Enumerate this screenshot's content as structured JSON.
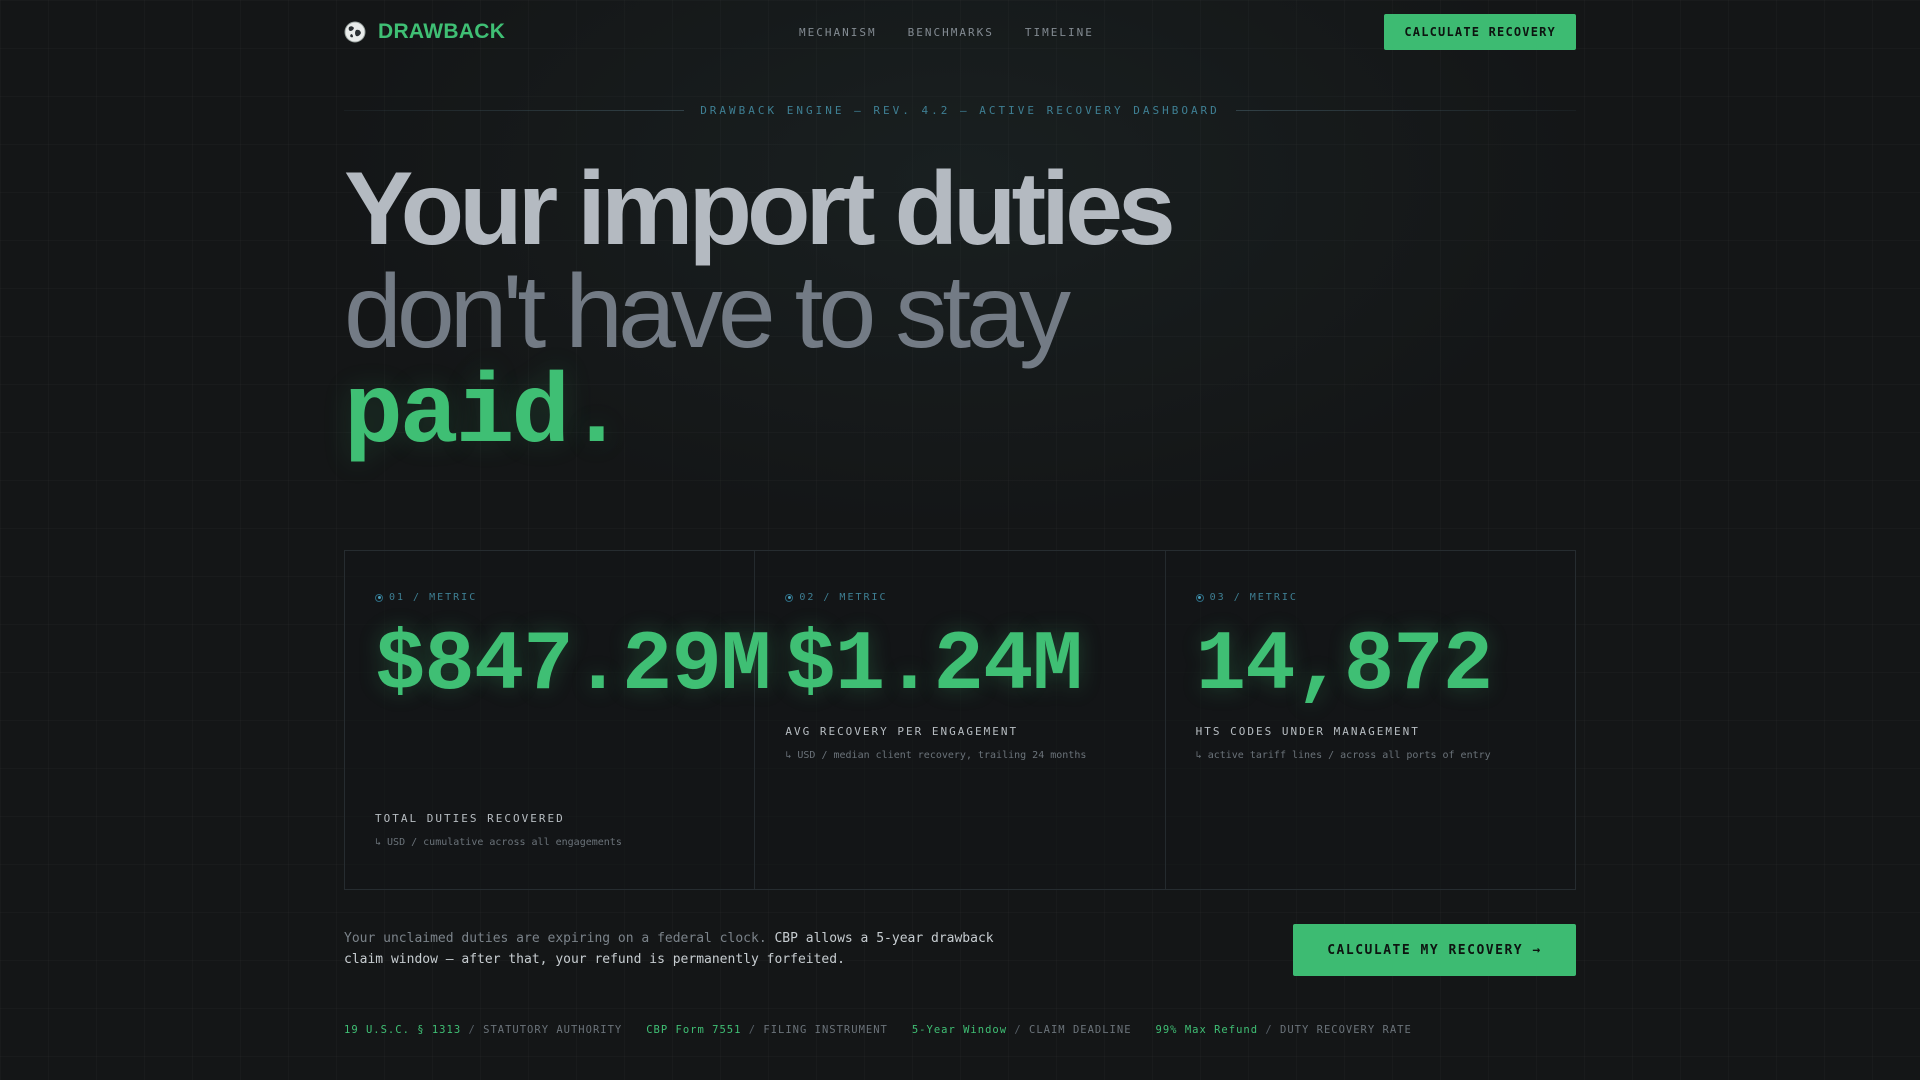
{
  "nav": {
    "brand": "DRAWBACK",
    "links": [
      "MECHANISM",
      "BENCHMARKS",
      "TIMELINE"
    ],
    "cta_label": "CALCULATE RECOVERY"
  },
  "ribbon": {
    "text": "DRAWBACK ENGINE — REV. 4.2 — ACTIVE RECOVERY DASHBOARD"
  },
  "hero": {
    "line1": "Your import duties",
    "line2": "don't have to stay",
    "line3": "paid."
  },
  "metrics": [
    {
      "tag": "01 / METRIC",
      "value": "$847.29M",
      "label": "TOTAL DUTIES RECOVERED",
      "sub": "↳ USD / cumulative across all engagements"
    },
    {
      "tag": "02 / METRIC",
      "value": "$1.24M",
      "label": "AVG RECOVERY PER ENGAGEMENT",
      "sub": "↳ USD / median client recovery, trailing 24 months"
    },
    {
      "tag": "03 / METRIC",
      "value": "14,872",
      "label": "HTS CODES UNDER MANAGEMENT",
      "sub": "↳ active tariff lines / across all ports of entry"
    }
  ],
  "notice": {
    "lead": "Your unclaimed duties are expiring on a federal clock.",
    "emphasis": "CBP allows a 5-year drawback claim window — after that, your refund is permanently forfeited."
  },
  "cta": {
    "label": "CALCULATE MY RECOVERY →"
  },
  "footer_stats": [
    {
      "key": "19 U.S.C. § 1313",
      "desc": "STATUTORY AUTHORITY"
    },
    {
      "key": "CBP Form 7551",
      "desc": "FILING INSTRUMENT"
    },
    {
      "key": "5-Year Window",
      "desc": "CLAIM DEADLINE"
    },
    {
      "key": "99% Max Refund",
      "desc": "DUTY RECOVERY RATE"
    }
  ],
  "colors": {
    "accent": "#3fbf74",
    "background": "#141617",
    "info": "#3e7f93"
  },
  "icons": {
    "brand": "globe-logo-icon",
    "metric_tag": "target-dot-icon"
  }
}
